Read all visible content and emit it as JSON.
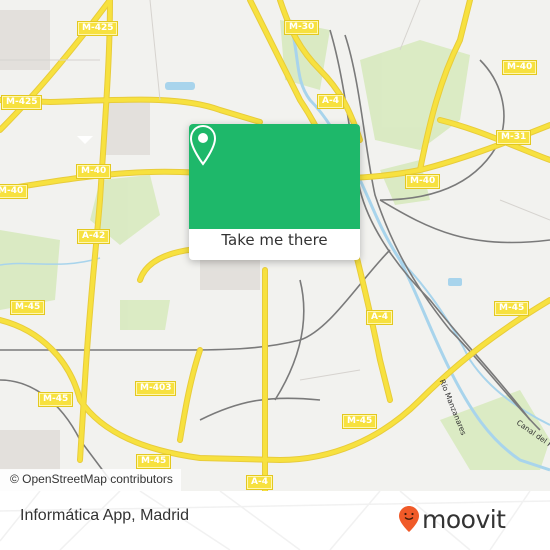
{
  "map": {
    "attribution": "© OpenStreetMap contributors",
    "road_labels": [
      {
        "id": "m425-top",
        "text": "M-425"
      },
      {
        "id": "m425-left",
        "text": "M-425"
      },
      {
        "id": "m30",
        "text": "M-30"
      },
      {
        "id": "a4-top",
        "text": "A-4"
      },
      {
        "id": "m40-right-top",
        "text": "M-40"
      },
      {
        "id": "m31",
        "text": "M-31"
      },
      {
        "id": "m40-center-right",
        "text": "M-40"
      },
      {
        "id": "m40-center-left",
        "text": "M-40"
      },
      {
        "id": "m40-left",
        "text": "M-40"
      },
      {
        "id": "a42",
        "text": "A-42"
      },
      {
        "id": "m45-left-top",
        "text": "M-45"
      },
      {
        "id": "m45-right",
        "text": "M-45"
      },
      {
        "id": "a4-mid",
        "text": "A-4"
      },
      {
        "id": "m403",
        "text": "M-403"
      },
      {
        "id": "m45-left-bottom",
        "text": "M-45"
      },
      {
        "id": "m45-mid-right",
        "text": "M-45"
      },
      {
        "id": "m45-bottom",
        "text": "M-45"
      },
      {
        "id": "a4-bottom",
        "text": "A-4"
      }
    ],
    "river_labels": {
      "manzanares": "Río Manzanares",
      "canal": "Canal del R"
    },
    "colors": {
      "background": "#f2f2ef",
      "road": "#f7e13f",
      "park": "#d4e8b8",
      "water": "#a8d4ec",
      "rail": "#777777"
    }
  },
  "popup": {
    "action_label": "Take me there",
    "icon": "map-pin-icon",
    "color": "#1eb86a"
  },
  "footer": {
    "place_name": "Informática App, Madrid",
    "brand": "moovit",
    "brand_icon": "moovit-smiley-pin-icon",
    "brand_color": "#f05a28"
  }
}
